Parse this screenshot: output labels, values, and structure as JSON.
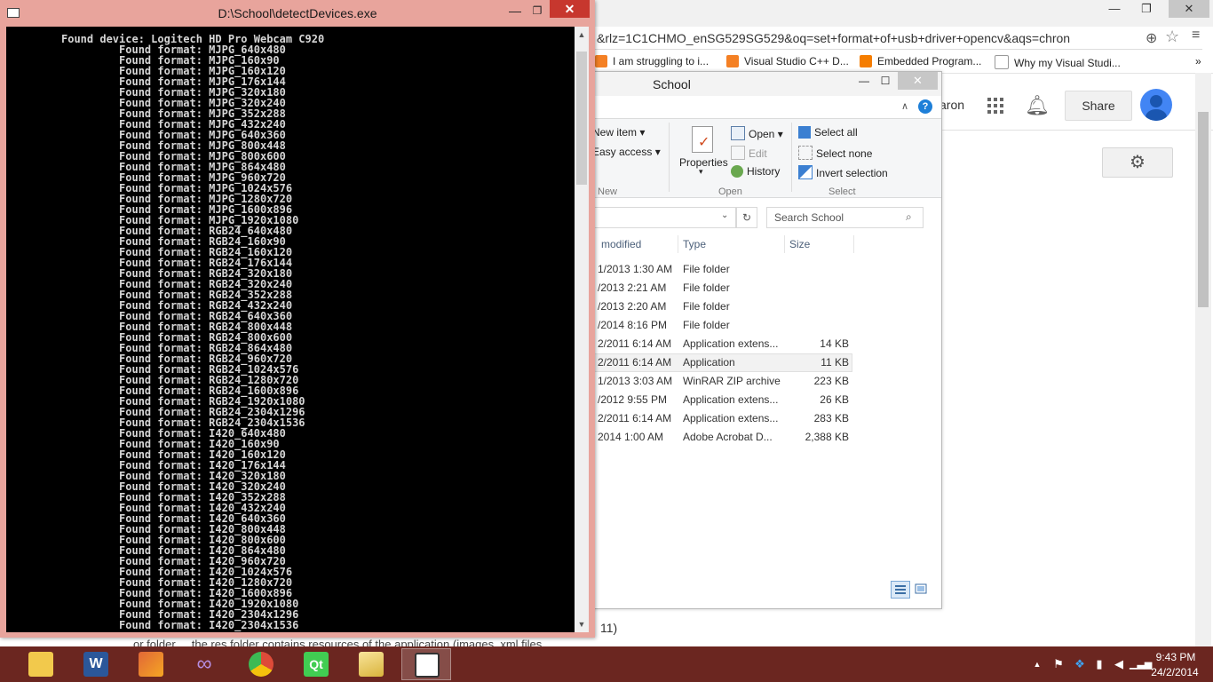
{
  "chrome": {
    "omnibox_text": "&rlz=1C1CHMO_enSG529SG529&oq=set+format+of+usb+driver+opencv&aqs=chron",
    "bookmarks": [
      {
        "label": "I am struggling to i...",
        "color": "#f48024"
      },
      {
        "label": "Visual Studio C++ D...",
        "color": "#f48024"
      },
      {
        "label": "Embedded Program...",
        "color": "#f57d00"
      },
      {
        "label": "Why my Visual Studi...",
        "color": "#ffffff"
      }
    ],
    "more_bookmarks": "»",
    "user_partial": "aron",
    "share_label": "Share",
    "page_text": "11)",
    "behind_text": "or folder ... the res folder contains resources of the application (images, xml files ..."
  },
  "explorer": {
    "title": "School",
    "ribbon": {
      "new_item": "New item",
      "easy_access": "Easy access",
      "new_group": "New",
      "properties": "Properties",
      "open": "Open",
      "edit": "Edit",
      "history": "History",
      "open_group": "Open",
      "select_all": "Select all",
      "select_none": "Select none",
      "invert_selection": "Invert selection",
      "select_group": "Select"
    },
    "search_placeholder": "Search School",
    "columns": {
      "modified": "modified",
      "type": "Type",
      "size": "Size"
    },
    "rows": [
      {
        "date": "1/2013 1:30 AM",
        "type": "File folder",
        "size": ""
      },
      {
        "date": "/2013 2:21 AM",
        "type": "File folder",
        "size": ""
      },
      {
        "date": "/2013 2:20 AM",
        "type": "File folder",
        "size": ""
      },
      {
        "date": "/2014 8:16 PM",
        "type": "File folder",
        "size": ""
      },
      {
        "date": "2/2011 6:14 AM",
        "type": "Application extens...",
        "size": "14 KB"
      },
      {
        "date": "2/2011 6:14 AM",
        "type": "Application",
        "size": "11 KB"
      },
      {
        "date": "1/2013 3:03 AM",
        "type": "WinRAR ZIP archive",
        "size": "223 KB"
      },
      {
        "date": "/2012 9:55 PM",
        "type": "Application extens...",
        "size": "26 KB"
      },
      {
        "date": "2/2011 6:14 AM",
        "type": "Application extens...",
        "size": "283 KB"
      },
      {
        "date": "2014 1:00 AM",
        "type": "Adobe Acrobat D...",
        "size": "2,388 KB"
      }
    ]
  },
  "console": {
    "title": "D:\\School\\detectDevices.exe",
    "device_line": "Found device: Logitech HD Pro Webcam C920",
    "format_prefix": "Found format: ",
    "formats": [
      "MJPG_640x480",
      "MJPG_160x90",
      "MJPG_160x120",
      "MJPG_176x144",
      "MJPG_320x180",
      "MJPG_320x240",
      "MJPG_352x288",
      "MJPG_432x240",
      "MJPG_640x360",
      "MJPG_800x448",
      "MJPG_800x600",
      "MJPG_864x480",
      "MJPG_960x720",
      "MJPG_1024x576",
      "MJPG_1280x720",
      "MJPG_1600x896",
      "MJPG_1920x1080",
      "RGB24_640x480",
      "RGB24_160x90",
      "RGB24_160x120",
      "RGB24_176x144",
      "RGB24_320x180",
      "RGB24_320x240",
      "RGB24_352x288",
      "RGB24_432x240",
      "RGB24_640x360",
      "RGB24_800x448",
      "RGB24_800x600",
      "RGB24_864x480",
      "RGB24_960x720",
      "RGB24_1024x576",
      "RGB24_1280x720",
      "RGB24_1600x896",
      "RGB24_1920x1080",
      "RGB24_2304x1296",
      "RGB24_2304x1536",
      "I420_640x480",
      "I420_160x90",
      "I420_160x120",
      "I420_176x144",
      "I420_320x180",
      "I420_320x240",
      "I420_352x288",
      "I420_432x240",
      "I420_640x360",
      "I420_800x448",
      "I420_800x600",
      "I420_864x480",
      "I420_960x720",
      "I420_1024x576",
      "I420_1280x720",
      "I420_1600x896",
      "I420_1920x1080",
      "I420_2304x1296",
      "I420_2304x1536"
    ]
  },
  "taskbar": {
    "apps": [
      {
        "name": "file-explorer",
        "color": "#f2c94c"
      },
      {
        "name": "word",
        "color": "#2b579a"
      },
      {
        "name": "matlab",
        "color": "#e16737"
      },
      {
        "name": "visual-studio",
        "color": "#68217a"
      },
      {
        "name": "chrome",
        "color": "#dd4b39"
      },
      {
        "name": "qt",
        "color": "#41cd52"
      },
      {
        "name": "explorer-school",
        "color": "#f2c94c"
      },
      {
        "name": "console",
        "color": "#dcdcdc"
      }
    ],
    "time": "9:43 PM",
    "date": "24/2/2014"
  },
  "colors": {
    "console_frame": "#e8a49c",
    "taskbar": "#6b2620",
    "close_red": "#c7372e"
  }
}
